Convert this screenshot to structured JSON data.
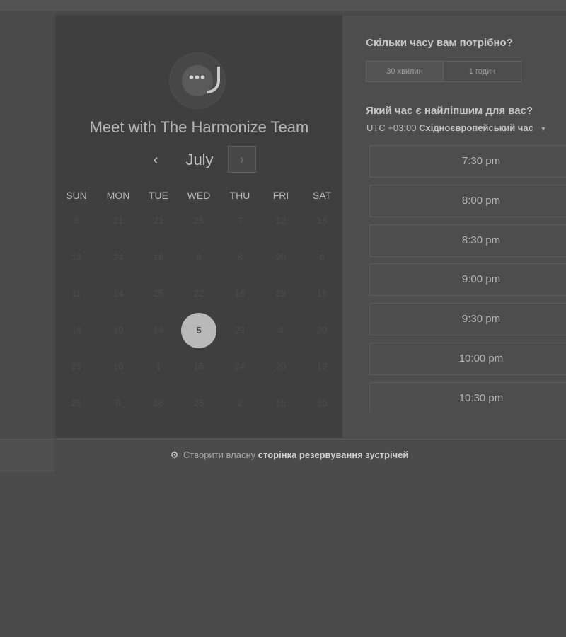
{
  "calendar": {
    "team_title": "Meet with The Harmonize Team",
    "month": "July",
    "prev_glyph": "‹",
    "next_glyph": "›",
    "logo_icon": "chat-bubble-icon",
    "logo_glyph": "•••",
    "weekdays": [
      "SUN",
      "MON",
      "TUE",
      "WED",
      "THU",
      "FRI",
      "SAT"
    ],
    "weeks": [
      [
        "6",
        "21",
        "21",
        "25",
        "7",
        "12",
        "16"
      ],
      [
        "13",
        "24",
        "16",
        "8",
        "8",
        "20",
        "6"
      ],
      [
        "11",
        "14",
        "25",
        "22",
        "18",
        "29",
        "18"
      ],
      [
        "14",
        "19",
        "14",
        "5",
        "22",
        "4",
        "20"
      ],
      [
        "25",
        "10",
        "1",
        "15",
        "24",
        "20",
        "19"
      ],
      [
        "25",
        "8",
        "26",
        "25",
        "2",
        "15",
        "10"
      ]
    ],
    "selected_day": "5"
  },
  "booking": {
    "duration_heading": "Скільки часу вам потрібно?",
    "durations": [
      "30 хвилин",
      "1 годин"
    ],
    "selected_duration": "30 хвилин",
    "time_heading": "Який час є найліпшим для вас?",
    "timezone_offset": "UTC +03:00",
    "timezone_name": "Східноєвропейський час",
    "timezone_arrow": "▼",
    "slots": [
      "7:30 pm",
      "8:00 pm",
      "8:30 pm",
      "9:00 pm",
      "9:30 pm",
      "10:00 pm",
      "10:30 pm"
    ]
  },
  "footer": {
    "icon": "hubspot-sprocket-icon",
    "icon_glyph": "⚙",
    "text": "Створити власну",
    "link": "сторінка резервування зустрічей"
  }
}
